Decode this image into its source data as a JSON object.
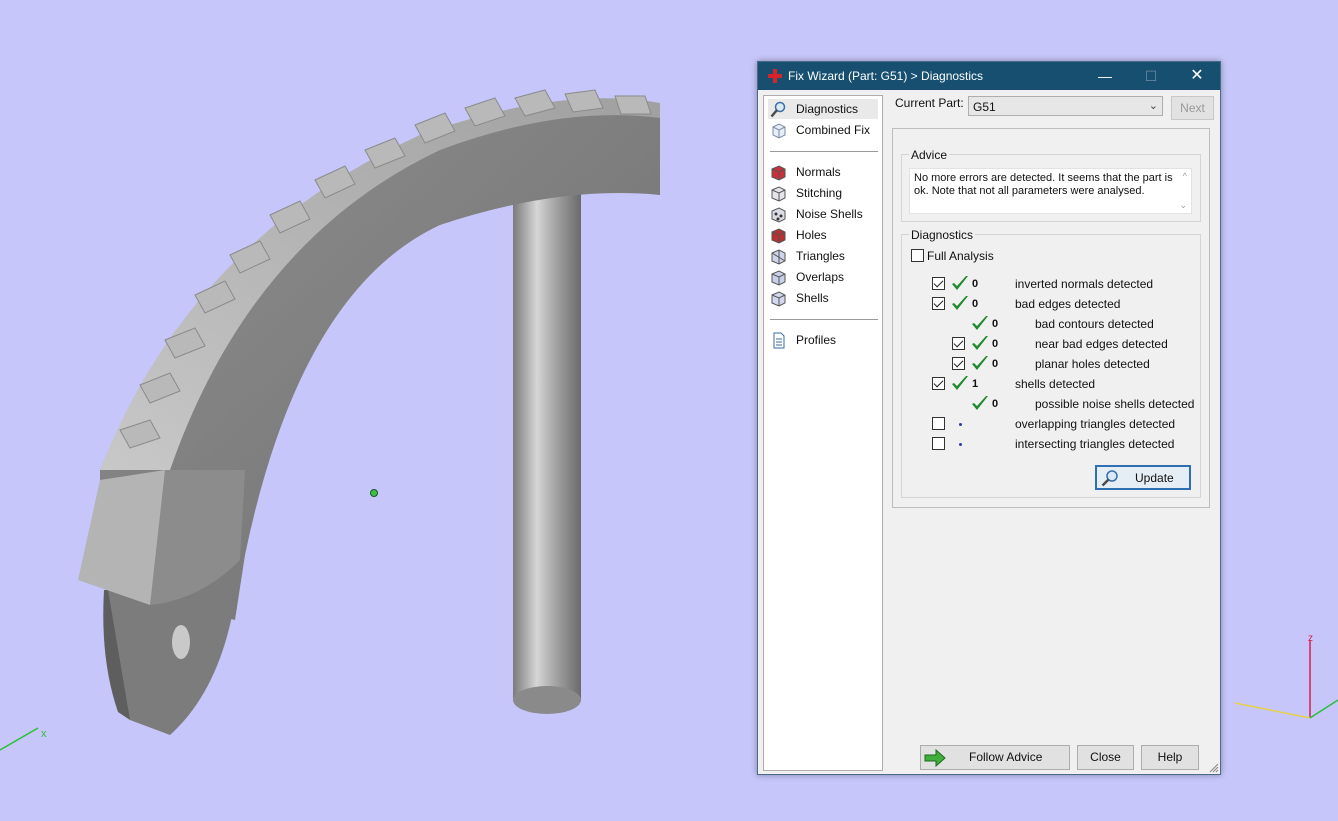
{
  "window": {
    "title": "Fix Wizard (Part: G51) > Diagnostics",
    "controls": [
      "minimize-icon",
      "maximize-icon",
      "close-icon"
    ]
  },
  "nav": {
    "items": [
      {
        "label": "Diagnostics",
        "icon": "magnifier-icon",
        "selected": true
      },
      {
        "label": "Combined Fix",
        "icon": "cube-icon"
      },
      {
        "label": "Normals",
        "icon": "normals-icon"
      },
      {
        "label": "Stitching",
        "icon": "stitching-icon"
      },
      {
        "label": "Noise Shells",
        "icon": "noise-shells-icon"
      },
      {
        "label": "Holes",
        "icon": "holes-icon"
      },
      {
        "label": "Triangles",
        "icon": "triangles-icon"
      },
      {
        "label": "Overlaps",
        "icon": "overlaps-icon"
      },
      {
        "label": "Shells",
        "icon": "shells-icon"
      },
      {
        "label": "Profiles",
        "icon": "document-icon"
      }
    ]
  },
  "part": {
    "label": "Current Part:",
    "value": "G51",
    "next_label": "Next"
  },
  "advice": {
    "legend": "Advice",
    "text": "No more errors are detected. It seems that the part is ok. Note that not all parameters were analysed."
  },
  "diagnostics": {
    "legend": "Diagnostics",
    "full_analysis_label": "Full Analysis",
    "full_analysis_checked": false,
    "rows": [
      {
        "checkbox": true,
        "checked": true,
        "status": "ok",
        "count": "0",
        "text": "inverted normals detected",
        "indent": 0
      },
      {
        "checkbox": true,
        "checked": true,
        "status": "ok",
        "count": "0",
        "text": "bad edges detected",
        "indent": 0
      },
      {
        "checkbox": false,
        "checked": false,
        "status": "ok",
        "count": "0",
        "text": "bad contours detected",
        "indent": 1
      },
      {
        "checkbox": true,
        "checked": true,
        "status": "ok",
        "count": "0",
        "text": "near bad edges detected",
        "indent": 1
      },
      {
        "checkbox": true,
        "checked": true,
        "status": "ok",
        "count": "0",
        "text": "planar holes detected",
        "indent": 1
      },
      {
        "checkbox": true,
        "checked": true,
        "status": "ok",
        "count": "1",
        "text": "shells detected",
        "indent": 0
      },
      {
        "checkbox": false,
        "checked": false,
        "status": "ok",
        "count": "0",
        "text": "possible noise shells detected",
        "indent": 1
      },
      {
        "checkbox": true,
        "checked": false,
        "status": "none",
        "count": "",
        "text": "overlapping triangles detected",
        "indent": 0
      },
      {
        "checkbox": true,
        "checked": false,
        "status": "none",
        "count": "",
        "text": "intersecting triangles detected",
        "indent": 0
      }
    ],
    "update_label": "Update"
  },
  "buttons": {
    "follow_advice": "Follow Advice",
    "close": "Close",
    "help": "Help"
  },
  "axes": {
    "x_label": "x",
    "z_label": "z"
  },
  "colors": {
    "background": "#c6c6fa",
    "titlebar": "#174f70",
    "check_green": "#1f8a2e",
    "model_gray": "#9a9a9a"
  }
}
